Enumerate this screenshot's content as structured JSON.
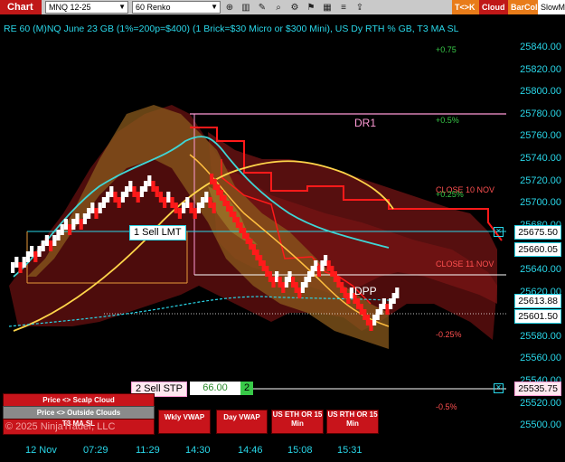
{
  "toolbar": {
    "chart_label": "Chart",
    "instrument": "MNQ 12-25",
    "bar_type": "60 Renko",
    "tc_label": "T<>K",
    "cloud_label": "Cloud",
    "barcol_label": "BarCol",
    "slow_label": "SlowM"
  },
  "header": {
    "title": "RE 60 (M)NQ June 23 GB (1%=200p=$400) (1 Brick=$30 Micro or $300 Mini), US Dy RTH % GB, T3 MA SL"
  },
  "price_axis": [
    "25840.00",
    "25820.00",
    "25800.00",
    "25780.00",
    "25760.00",
    "25740.00",
    "25720.00",
    "25700.00",
    "25680.00",
    "25660.00",
    "25640.00",
    "25620.00",
    "25600.00",
    "25580.00",
    "25560.00",
    "25540.00",
    "25520.00",
    "25500.00"
  ],
  "price_tags": {
    "tag1": "25675.50",
    "tag2": "25660.05",
    "tag3": "25613.88",
    "tag4": "25601.50",
    "tag5": "25535.75"
  },
  "levels": {
    "p075": "+0.75",
    "dr1": "DR1",
    "p05": "+0.5%",
    "close10": "CLOSE 10 NOV",
    "p025": "+0.25%",
    "close11": "CLOSE 11 NOV",
    "dpp": "DPP",
    "m025": "-0.25%",
    "m05": "-0.5%"
  },
  "orders": {
    "sell_lmt": "1 Sell LMT",
    "sell_stp": "2 Sell STP",
    "stp_price": "66.00",
    "stp_qty": "2"
  },
  "time_axis": [
    "12 Nov",
    "07:29",
    "11:29",
    "14:30",
    "14:46",
    "15:08",
    "15:31"
  ],
  "buttons": {
    "scalp": "Price <> Scalp Cloud",
    "outside": "Price <> Outside Clouds",
    "t3": "T3 MA SL",
    "wkly": "Wkly VWAP",
    "day": "Day VWAP",
    "eth": "US ETH OR 15 Min",
    "rth": "US RTH OR 15 Min"
  },
  "copyright": "© 2025 NinjaTrader, LLC",
  "colors": {
    "accent": "#29d6e8",
    "up": "#ffffff",
    "down": "#ff1a1a",
    "ma_yellow": "#ffd54a",
    "ma_cyan": "#3fd6d6",
    "green": "#38c948"
  }
}
